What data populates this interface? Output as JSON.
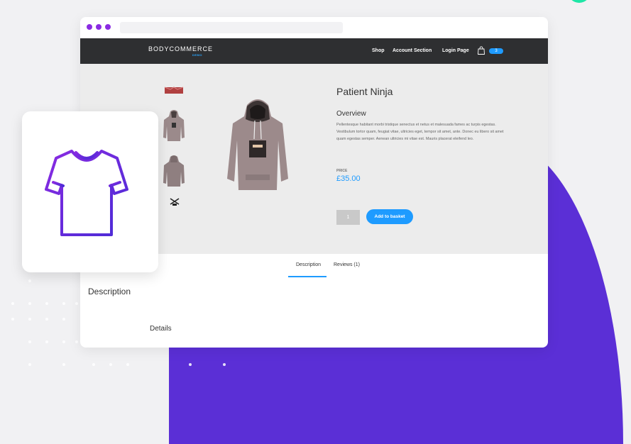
{
  "browser": {
    "window_controls": [
      "close",
      "minimize",
      "maximize"
    ]
  },
  "site": {
    "logo": "BODYCOMMERCE",
    "logo_sub": "DEMO",
    "nav": [
      "Shop",
      "Account Section",
      "Login Page"
    ],
    "cart_count": "3"
  },
  "product": {
    "title": "Patient Ninja",
    "overview_heading": "Overview",
    "overview_text": "Pellentesque habitant morbi tristique senectus et netus et malesuada fames ac turpis egestas. Vestibulum tortor quam, feugiat vitae, ultricies eget, tempor sit amet, ante. Donec eu libero sit amet quam egestas semper. Aenean ultricies mi vitae est. Mauris placerat eleifend leo.",
    "price_label": "PRICE",
    "price": "£35.00",
    "quantity": "1",
    "add_to_basket": "Add to basket"
  },
  "tabs": [
    "Description",
    "Reviews (1)"
  ],
  "active_tab": "Description",
  "section_title": "Description",
  "details_heading": "Details",
  "feature_card": {
    "icon": "t-shirt-icon"
  },
  "colors": {
    "accent": "#1e9bff",
    "brand_purple": "#5b2fd6",
    "icon_gradient_start": "#8a2be2",
    "icon_gradient_end": "#4a2bd6",
    "nav_bg": "#2e2f31"
  }
}
